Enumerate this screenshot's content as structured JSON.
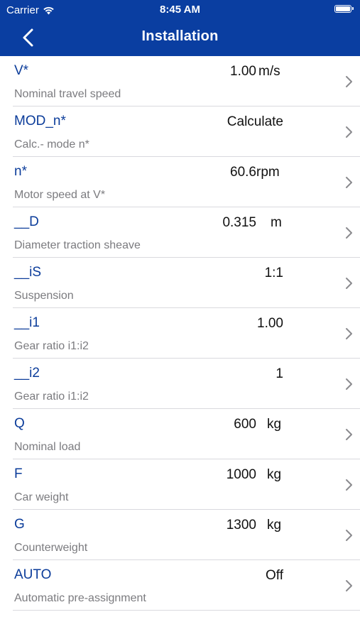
{
  "status_bar": {
    "carrier": "Carrier",
    "time": "8:45 AM"
  },
  "nav": {
    "title": "Installation"
  },
  "colors": {
    "header_bg": "#0a3ea1",
    "param_name": "#0b3c9a",
    "description": "#7b7b7f"
  },
  "rows": [
    {
      "name": "V*",
      "value": "1.00",
      "unit": "m/s",
      "desc": "Nominal travel speed"
    },
    {
      "name": "MOD_n*",
      "value": "Calculate",
      "unit": "",
      "desc": "Calc.- mode n*"
    },
    {
      "name": "n*",
      "value": "60.6",
      "unit": "rpm",
      "desc": "Motor speed at V*"
    },
    {
      "name": "__D",
      "value": "0.315",
      "unit": "m",
      "desc": "Diameter traction sheave"
    },
    {
      "name": "__iS",
      "value": "1:1",
      "unit": "",
      "desc": "Suspension"
    },
    {
      "name": "__i1",
      "value": "1.00",
      "unit": "",
      "desc": "Gear ratio i1:i2"
    },
    {
      "name": "__i2",
      "value": "1",
      "unit": "",
      "desc": "Gear ratio i1:i2"
    },
    {
      "name": "Q",
      "value": "600",
      "unit": "kg",
      "desc": "Nominal load"
    },
    {
      "name": "F",
      "value": "1000",
      "unit": "kg",
      "desc": "Car weight"
    },
    {
      "name": "G",
      "value": "1300",
      "unit": "kg",
      "desc": "Counterweight"
    },
    {
      "name": "AUTO",
      "value": "Off",
      "unit": "",
      "desc": "Automatic pre-assignment"
    }
  ]
}
